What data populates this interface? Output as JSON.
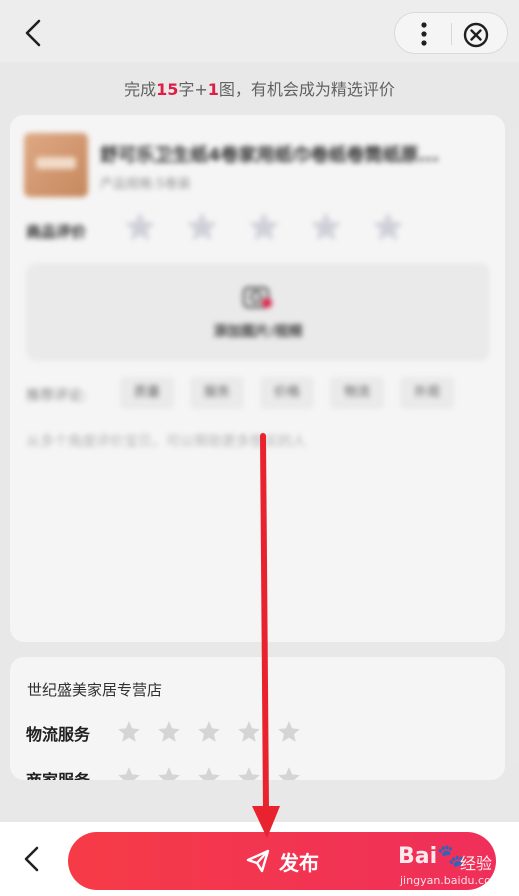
{
  "header": {
    "back_icon": "chevron-left-icon",
    "more_icon": "more-vertical-icon",
    "close_icon": "close-circle-icon"
  },
  "hint": {
    "prefix": "完成",
    "num_chars": "15",
    "mid": "字+",
    "num_images": "1",
    "suffix": "图，有机会成为精选评价"
  },
  "product_card": {
    "title": "舒可乐卫生纸4卷家用纸巾卷纸卷筒纸原...",
    "subtitle": "产品规格:5卷装",
    "rating_label": "商品评价",
    "rating_value": 0,
    "rating_max": 5,
    "upload_label": "添加图片/视频",
    "upload_icon": "camera-plus-icon",
    "tags_label": "推荐评论:",
    "tags": [
      "质量",
      "服务",
      "价格",
      "物流",
      "外观"
    ],
    "comment_placeholder": "从多个角度评价宝贝，可以帮助更多想买的人"
  },
  "shop_card": {
    "shop_name": "世纪盛美家居专营店",
    "services": [
      {
        "label": "物流服务",
        "rating": 0,
        "max": 5
      },
      {
        "label": "商家服务",
        "rating": 0,
        "max": 5
      }
    ]
  },
  "bottom": {
    "back_icon": "chevron-left-icon",
    "publish_label": "发布",
    "publish_icon": "send-icon"
  },
  "watermark": {
    "brand": "Bai🐾",
    "brand_cn": "经验",
    "url": "jingyan.baidu.com"
  },
  "colors": {
    "accent": "#e6204a",
    "publish_start": "#f63b47",
    "publish_end": "#ef2f5a",
    "arrow": "#e8232f"
  }
}
